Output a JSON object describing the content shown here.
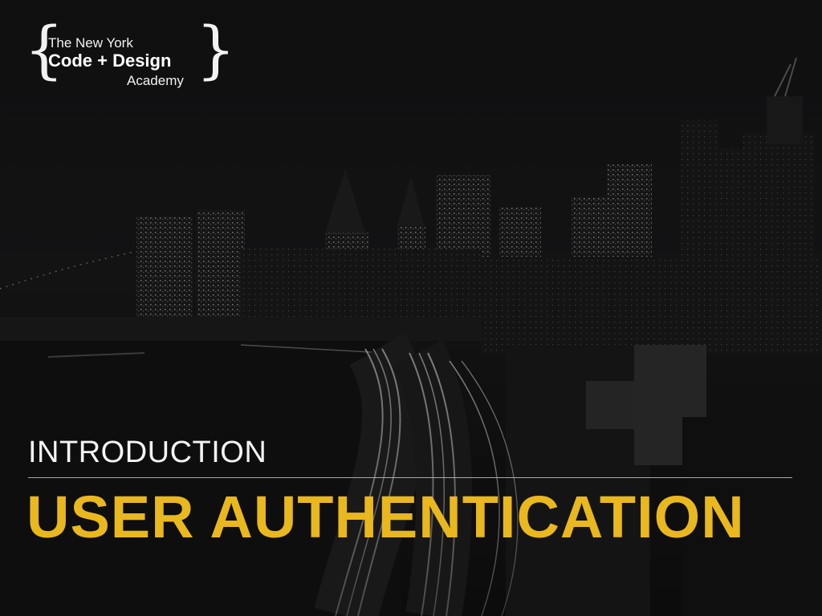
{
  "logo": {
    "brace_left": "{",
    "brace_right": "}",
    "line1": "The New York",
    "line2": "Code + Design",
    "line3": "Academy"
  },
  "slide": {
    "overline": "INTRODUCTION",
    "title": "USER AUTHENTICATION"
  },
  "colors": {
    "title": "#e9b71e",
    "overline": "#f4f4f4",
    "background": "#0f0f10"
  }
}
